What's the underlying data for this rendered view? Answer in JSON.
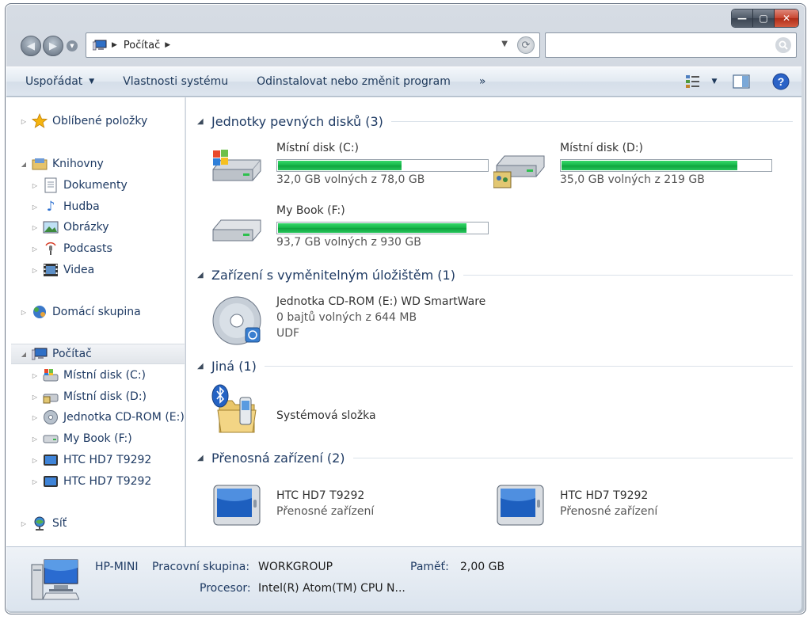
{
  "window": {
    "buttons": [
      "—",
      "▢",
      "✕"
    ]
  },
  "address": {
    "crumb": "Počítač",
    "search_placeholder": ""
  },
  "toolbar": {
    "organize": "Uspořádat",
    "system_properties": "Vlastnosti systému",
    "uninstall": "Odinstalovat nebo změnit program",
    "more": "»"
  },
  "nav": {
    "favorites": "Oblíbené položky",
    "libraries": "Knihovny",
    "documents": "Dokumenty",
    "music": "Hudba",
    "pictures": "Obrázky",
    "podcasts": "Podcasts",
    "videos": "Videa",
    "homegroup": "Domácí skupina",
    "computer": "Počítač",
    "drive_c": "Místní disk (C:)",
    "drive_d": "Místní disk (D:)",
    "cdrom": "Jednotka CD-ROM (E:)",
    "mybook": "My Book (F:)",
    "htc1": "HTC HD7 T9292",
    "htc2": "HTC HD7 T9292",
    "network": "Síť"
  },
  "groups": {
    "hdd": "Jednotky pevných disků (3)",
    "removable": "Zařízení s vyměnitelným úložištěm (1)",
    "other": "Jiná (1)",
    "portable": "Přenosná zařízení (2)"
  },
  "drives": [
    {
      "name": "Místní disk (C:)",
      "free": "32,0 GB volných z 78,0 GB",
      "used_fraction": 0.59
    },
    {
      "name": "Místní disk (D:)",
      "free": "35,0 GB volných z 219 GB",
      "used_fraction": 0.84
    },
    {
      "name": "My Book (F:)",
      "free": "93,7 GB volných z 930 GB",
      "used_fraction": 0.9
    }
  ],
  "cdrom": {
    "name": "Jednotka CD-ROM (E:) WD SmartWare",
    "free": "0 bajtů volných z 644 MB",
    "fs": "UDF"
  },
  "system_folder": {
    "name": "Systémová složka"
  },
  "portable": [
    {
      "name": "HTC HD7 T9292",
      "type": "Přenosné zařízení"
    },
    {
      "name": "HTC HD7 T9292",
      "type": "Přenosné zařízení"
    }
  ],
  "details": {
    "pc_name": "HP-MINI",
    "workgroup_label": "Pracovní skupina:",
    "workgroup": "WORKGROUP",
    "memory_label": "Paměť:",
    "memory": "2,00 GB",
    "cpu_label": "Procesor:",
    "cpu": "Intel(R) Atom(TM) CPU N..."
  }
}
